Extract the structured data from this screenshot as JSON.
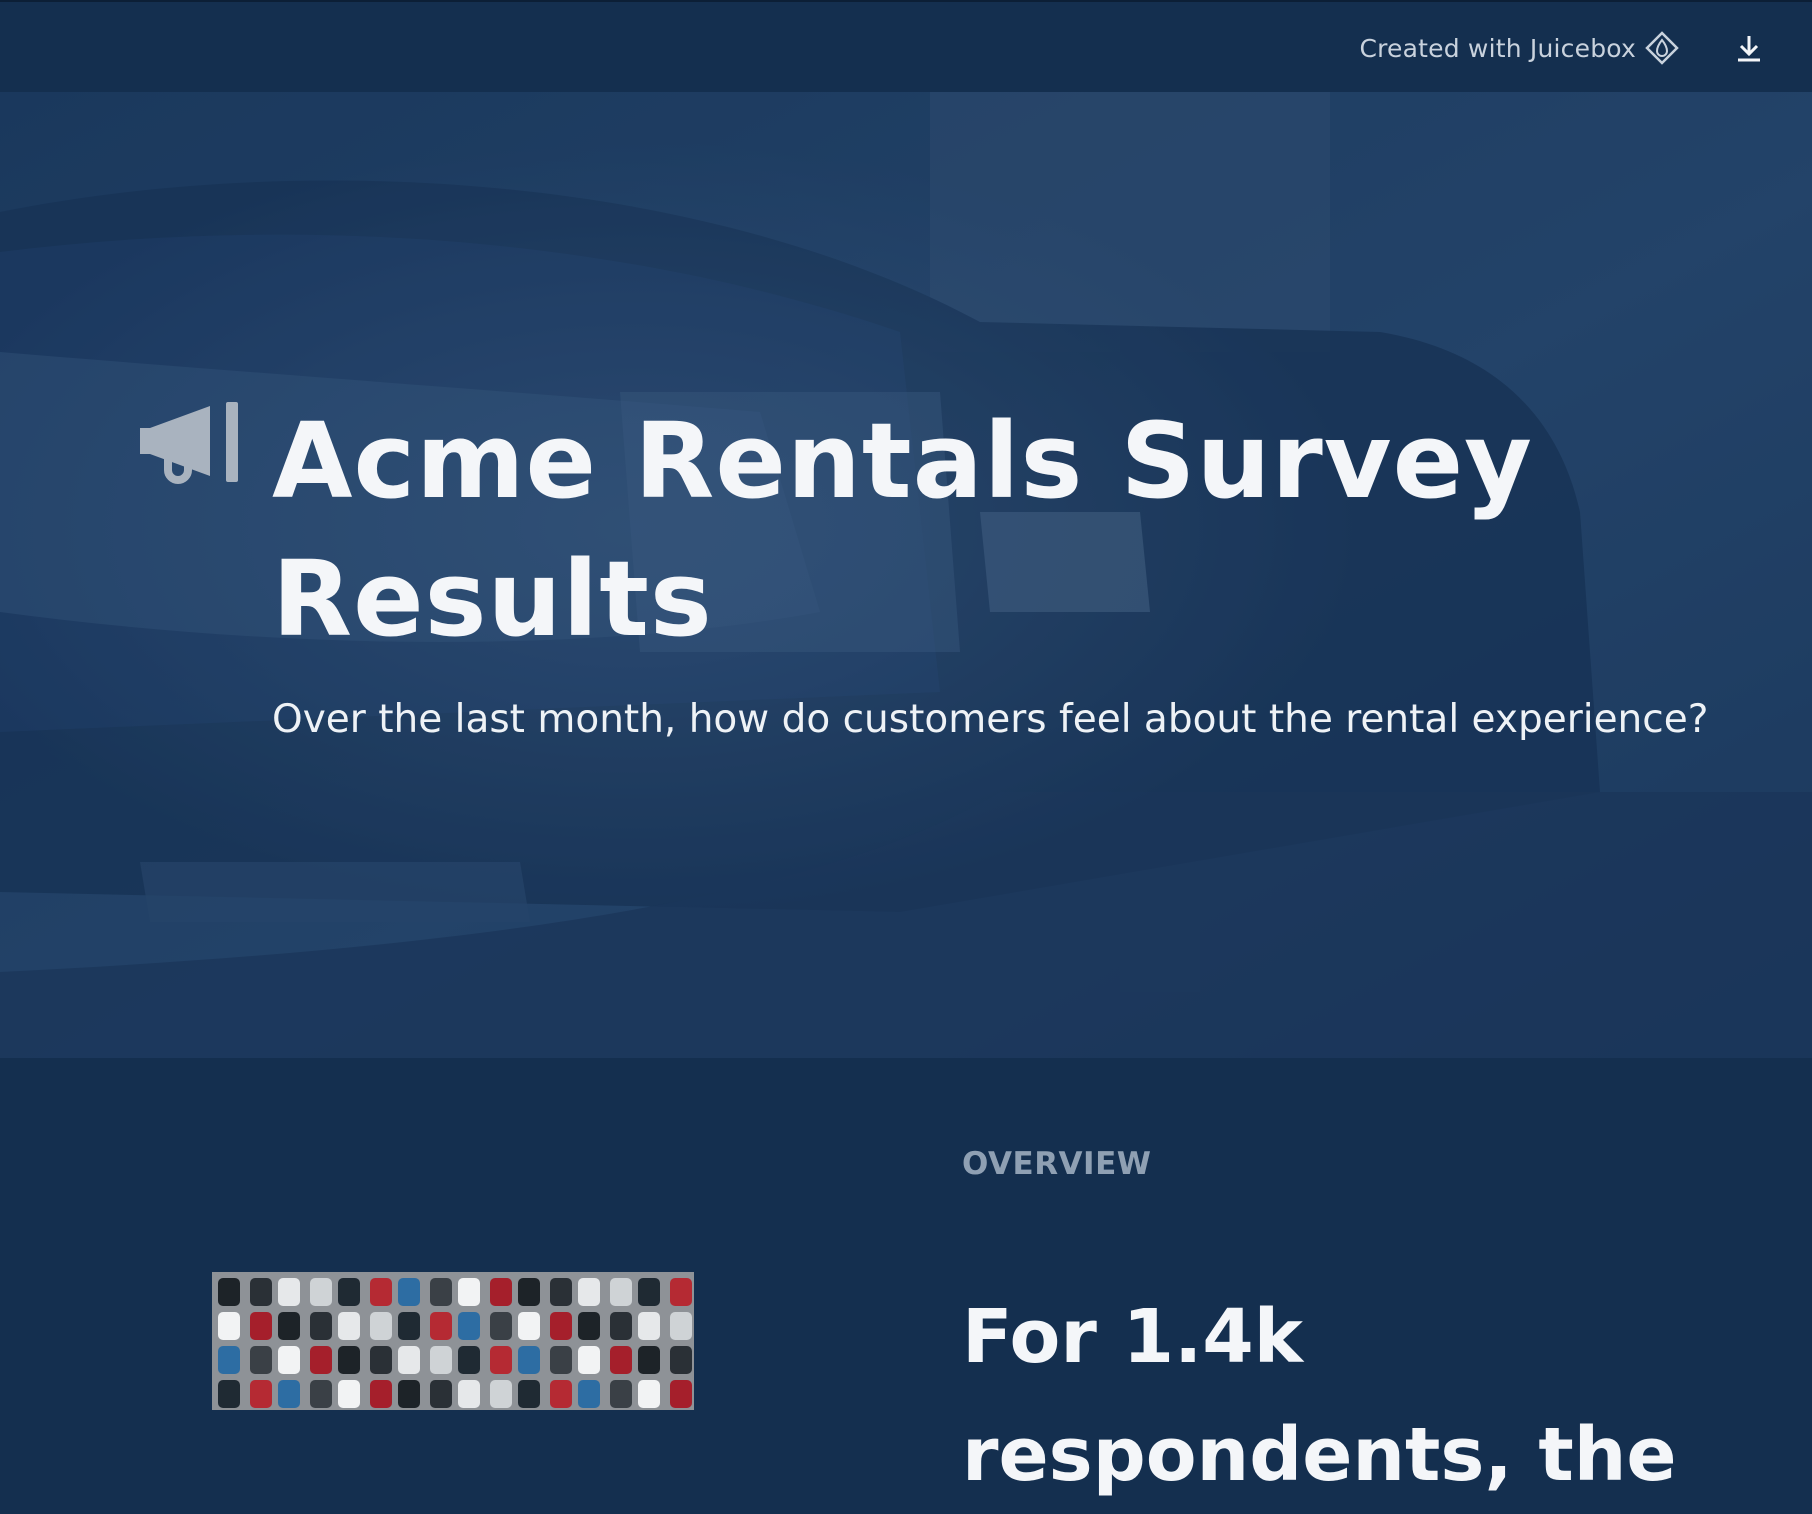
{
  "header": {
    "credit_text": "Created with Juicebox",
    "logo_icon": "juicebox-diamond-icon",
    "download_icon": "download-icon"
  },
  "hero": {
    "icon": "megaphone-icon",
    "title": "Acme Rentals Survey Results",
    "subtitle": "Over the last month, how do customers feel about the rental experience?"
  },
  "overview": {
    "label": "OVERVIEW",
    "headline_prefix": "For ",
    "headline_value": "1.4k",
    "headline_rest": " respondents, the"
  },
  "colors": {
    "background": "#142f4f",
    "text": "#f4f6f9",
    "muted": "#8fa0b3"
  }
}
